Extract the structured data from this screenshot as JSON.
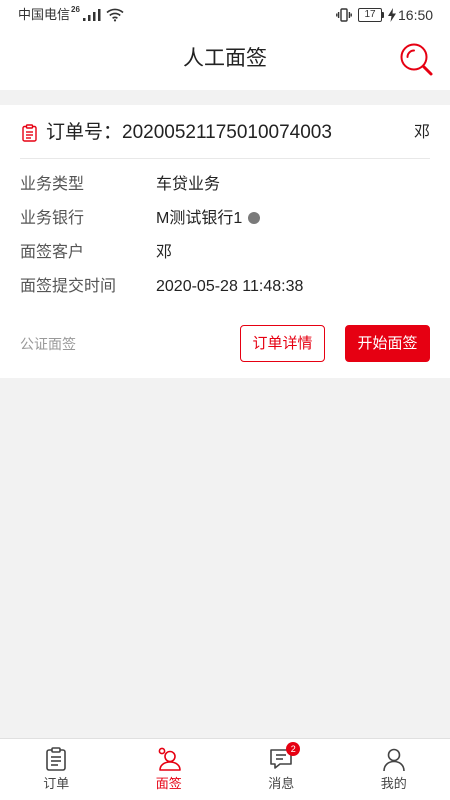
{
  "status_bar": {
    "carrier": "中国电信",
    "network": "26",
    "battery": "17",
    "time": "16:50"
  },
  "header": {
    "title": "人工面签",
    "action_icon": "search-icon"
  },
  "order": {
    "number_label": "订单号：",
    "number": "20200521175010074003",
    "customer_short": "邓",
    "fields": [
      {
        "label": "业务类型",
        "value": "车贷业务"
      },
      {
        "label": "业务银行",
        "value": "M测试银行1",
        "status_color": "#7a7a7a"
      },
      {
        "label": "面签客户",
        "value": "邓"
      },
      {
        "label": "面签提交时间",
        "value": "2020-05-28 11:48:38"
      }
    ],
    "sign_type": "公证面签",
    "detail_button": "订单详情",
    "start_button": "开始面签"
  },
  "tabbar": {
    "items": [
      {
        "label": "订单",
        "icon": "clipboard-icon",
        "active": false
      },
      {
        "label": "面签",
        "icon": "face-sign-icon",
        "active": true
      },
      {
        "label": "消息",
        "icon": "message-icon",
        "active": false,
        "badge": "2"
      },
      {
        "label": "我的",
        "icon": "profile-icon",
        "active": false
      }
    ]
  },
  "colors": {
    "accent": "#e60012",
    "background": "#f2f2f2",
    "inactive": "#444444"
  }
}
